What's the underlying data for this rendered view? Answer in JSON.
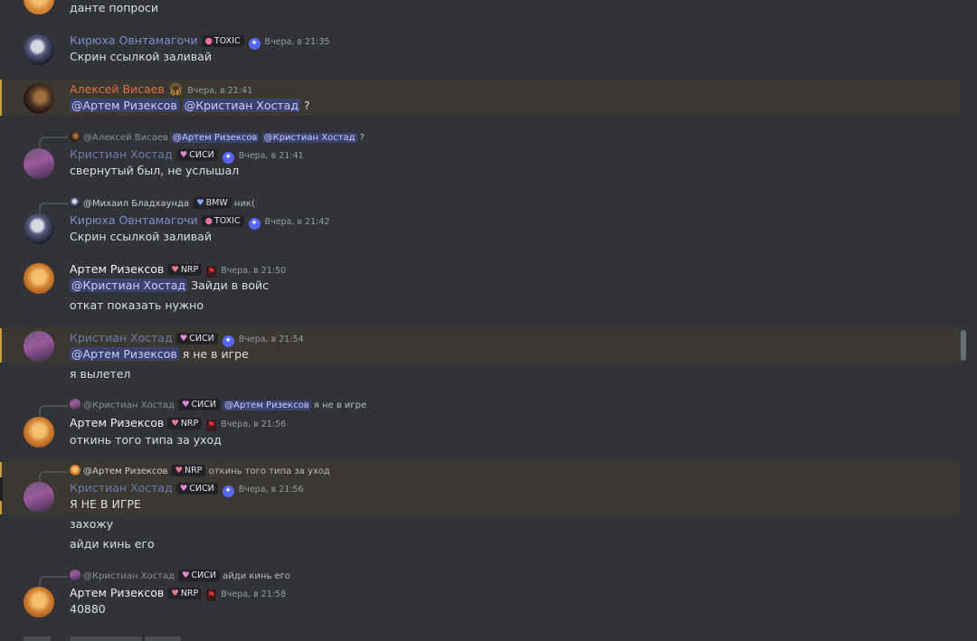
{
  "messages": {
    "m0": {
      "text": "данте попроси"
    },
    "m1": {
      "name": "Кирюха Овнтамагочи",
      "tag": "TOXIC",
      "time": "Вчера, в 21:35",
      "text": "Скрин ссылкой заливай"
    },
    "m2": {
      "name": "Алексей Висаев",
      "time": "Вчера, в 21:41",
      "mention1": "@Артем Ризексов",
      "mention2": "@Кристиан Хостад",
      "tail": " ?"
    },
    "m3": {
      "reply": {
        "name": "@Алексей Висаев",
        "mention1": "@Артем Ризексов",
        "mention2": "@Кристиан Хостад",
        "tail": " ?"
      },
      "name": "Кристиан Хостад",
      "tag": "СИСИ",
      "time": "Вчера, в 21:41",
      "text": "свернутый был, не услышал"
    },
    "m4": {
      "reply": {
        "name": "@Михаил Бладхаунда",
        "tag": "BMW",
        "text": "ник("
      },
      "name": "Кирюха Овнтамагочи",
      "tag": "TOXIC",
      "time": "Вчера, в 21:42",
      "text": "Скрин ссылкой заливай"
    },
    "m5": {
      "name": "Артем Ризексов",
      "tag": "NRP",
      "time": "Вчера, в 21:50",
      "mention": "@Кристиан Хостад",
      "text1": " Зайди в войс",
      "text2": "откат показать нужно"
    },
    "m6": {
      "name": "Кристиан Хостад",
      "tag": "СИСИ",
      "time": "Вчера, в 21:54",
      "mention": "@Артем Ризексов",
      "text1": " я не в игре",
      "text2": "я вылетел"
    },
    "m7": {
      "reply": {
        "name": "@Кристиан Хостад",
        "tag": "СИСИ",
        "mention": "@Артем Ризексов",
        "text": " я не в игре"
      },
      "name": "Артем Ризексов",
      "tag": "NRP",
      "time": "Вчера, в 21:56",
      "text": "откинь того типа за уход"
    },
    "m8": {
      "reply": {
        "name": "@Артем Ризексов",
        "tag": "NRP",
        "text": "откинь того типа за уход"
      },
      "name": "Кристиан Хостад",
      "tag": "СИСИ",
      "time": "Вчера, в 21:56",
      "text1": "Я НЕ В ИГРЕ",
      "text2": "захожу",
      "text3": "айди кинь его"
    },
    "m9": {
      "reply": {
        "name": "@Кристиан Хостад",
        "tag": "СИСИ",
        "text": "айди кинь его"
      },
      "name": "Артем Ризексов",
      "tag": "NRP",
      "time": "Вчера, в 21:58",
      "text": "40880"
    }
  },
  "icons": {
    "server_badge": "shield-badge-icon",
    "headset": "headset-icon",
    "role_badge": "red-role-badge-icon"
  },
  "colors": {
    "background": "#323339",
    "highlight": "#3a3830",
    "mention_bg": "#3c4270",
    "mention_fg": "#c9cdfb",
    "name_orange": "#e07040"
  }
}
